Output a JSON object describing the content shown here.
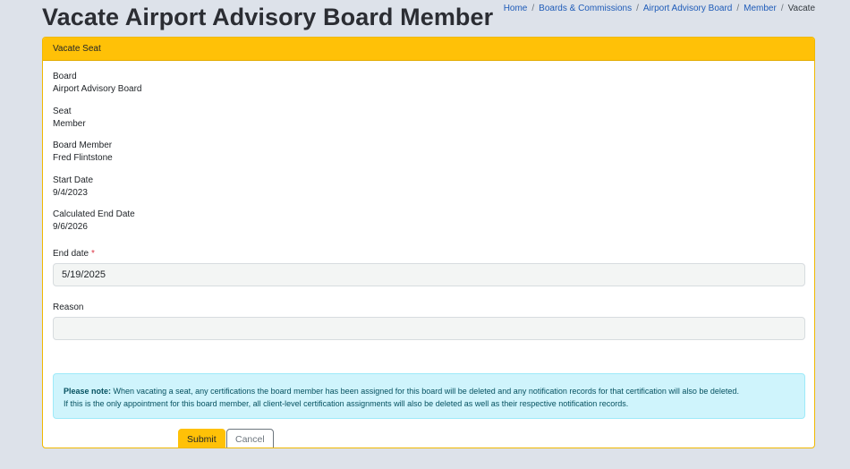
{
  "page": {
    "title": "Vacate Airport Advisory Board Member"
  },
  "breadcrumb": {
    "items": [
      "Home",
      "Boards & Commissions",
      "Airport Advisory Board",
      "Member"
    ],
    "current": "Vacate"
  },
  "card": {
    "header": "Vacate Seat",
    "fields": [
      {
        "label": "Board",
        "value": "Airport Advisory Board"
      },
      {
        "label": "Seat",
        "value": "Member"
      },
      {
        "label": "Board Member",
        "value": "Fred Flintstone"
      },
      {
        "label": "Start Date",
        "value": "9/4/2023"
      },
      {
        "label": "Calculated End Date",
        "value": "9/6/2026"
      }
    ]
  },
  "form": {
    "end_date": {
      "label": "End date",
      "required_marker": "*",
      "value": "5/19/2025"
    },
    "reason": {
      "label": "Reason",
      "value": ""
    }
  },
  "note": {
    "bold": "Please note:",
    "line1": "When vacating a seat, any certifications the board member has been assigned for this board will be deleted and any notification records for that certification will also be deleted.",
    "line2": "If this is the only appointment for this board member, all client-level certification assignments will also be deleted as well as their respective notification records."
  },
  "buttons": {
    "submit": "Submit",
    "cancel": "Cancel"
  },
  "colors": {
    "accent": "#ffc107",
    "link": "#1e5bb8",
    "note_bg": "#cff4fc",
    "required": "#dc3545"
  }
}
